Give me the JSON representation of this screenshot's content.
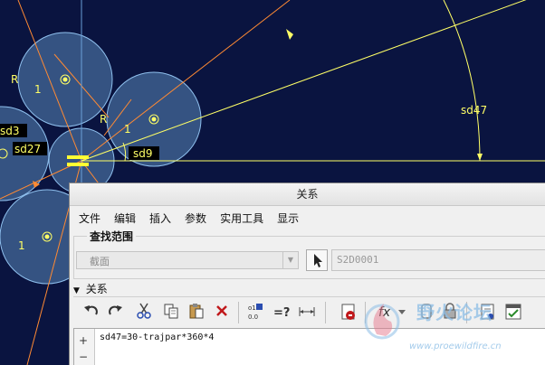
{
  "cad": {
    "labels": {
      "r_upper": "R",
      "r_mid": "R",
      "one_top": "1",
      "one_mid": "1",
      "one_bottom": "1",
      "sd3": "sd3",
      "sd27": "sd27",
      "sd9": "sd9",
      "sd47": "sd47"
    },
    "colors": {
      "background": "#0a1440",
      "circle_fill": "#5a87b8",
      "circle_stroke": "#8fc0ee",
      "dimension": "#ffff66",
      "axis": "#ff8a33",
      "label_bg": "#000000"
    }
  },
  "dialog": {
    "title": "关系",
    "menu": [
      "文件",
      "编辑",
      "插入",
      "参数",
      "实用工具",
      "显示"
    ],
    "scope": {
      "title": "查找范围",
      "select_value": "截面",
      "object_value": "S2D0001"
    },
    "relations_section": "关系",
    "toolbar_icons": [
      "undo-icon",
      "redo-icon",
      "cut-icon",
      "copy-icon",
      "paste-icon",
      "delete-icon",
      "units-icon",
      "evaluate-icon",
      "sort-icon",
      "verify-icon",
      "function-icon",
      "parameter-icon",
      "lock-icon",
      "report-icon",
      "check-icon"
    ],
    "editor": {
      "line": "sd47=30-trajpar*360*4",
      "add_button": "+",
      "remove_button": "−"
    }
  },
  "watermark": {
    "text": "野火论坛",
    "url": "www.proewildfire.cn"
  }
}
